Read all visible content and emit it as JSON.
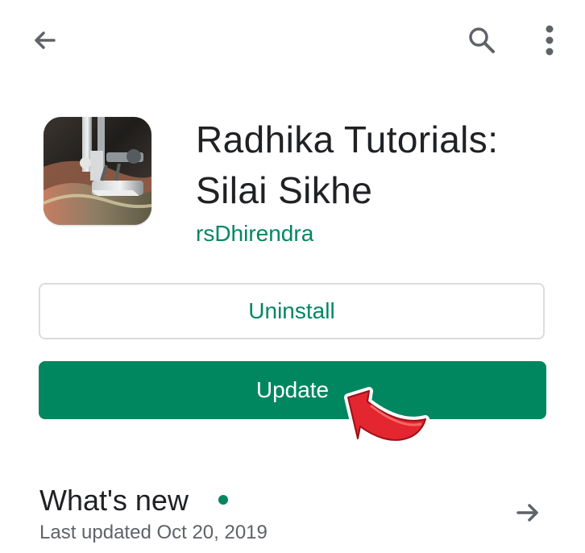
{
  "toolbar": {
    "back_icon": "back-arrow-icon",
    "search_icon": "search-icon",
    "more_icon": "more-vertical-icon"
  },
  "app": {
    "icon": "sewing-machine-app-icon",
    "title": "Radhika Tutorials: Silai Sikhe",
    "developer": "rsDhirendra"
  },
  "actions": {
    "uninstall_label": "Uninstall",
    "update_label": "Update"
  },
  "whats_new": {
    "title": "What's new",
    "last_updated": "Last updated Oct 20, 2019",
    "arrow_icon": "right-arrow-icon"
  },
  "colors": {
    "brand_green": "#01875f",
    "annotation_red": "#e3262f",
    "text_primary": "#202124",
    "text_secondary": "#5f6368",
    "border": "#dadce0"
  }
}
